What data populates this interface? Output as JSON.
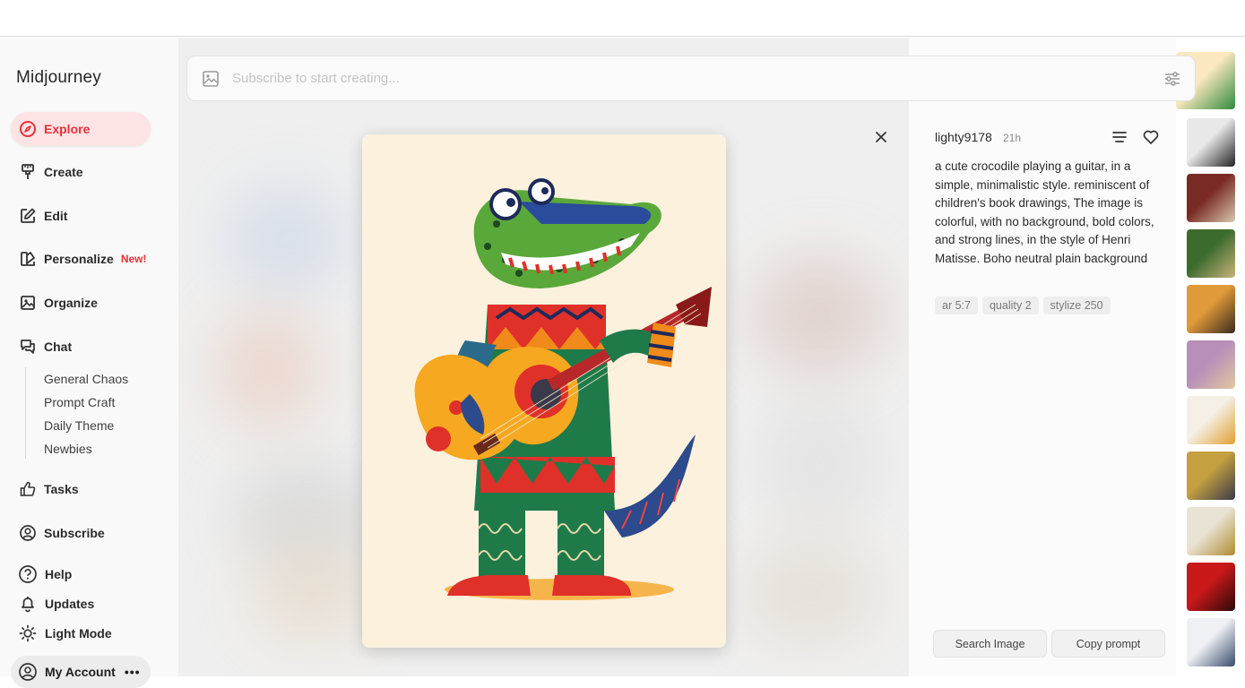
{
  "sidebar": {
    "brand": "Midjourney",
    "nav": {
      "explore": "Explore",
      "create": "Create",
      "edit": "Edit",
      "personalize": "Personalize",
      "personalize_badge": "New!",
      "organize": "Organize",
      "chat": "Chat"
    },
    "chat_channels": [
      "General Chaos",
      "Prompt Craft",
      "Daily Theme",
      "Newbies"
    ],
    "bottom": {
      "tasks": "Tasks",
      "subscribe": "Subscribe",
      "help": "Help",
      "updates": "Updates",
      "light_mode": "Light Mode",
      "account": "My Account"
    },
    "accent_color": "#e5323b"
  },
  "search": {
    "placeholder": "Subscribe to start creating..."
  },
  "detail": {
    "author": "lighty9178",
    "age": "21h",
    "prompt": "a cute crocodile playing a guitar, in a simple, minimalistic style. reminiscent of children's book drawings, The image is colorful, with no background, bold colors, and strong lines, in the style of Henri Matisse. Boho neutral plain background",
    "tags": [
      "ar 5:7",
      "quality 2",
      "stylize 250"
    ],
    "search_image_label": "Search Image",
    "copy_prompt_label": "Copy prompt"
  },
  "thumbnails": [
    {
      "name": "thumb-crocodile",
      "colors": [
        "#fbe8c0",
        "#2f8a3a"
      ]
    },
    {
      "name": "thumb-ink-smoke",
      "colors": [
        "#e8e8e8",
        "#222222"
      ]
    },
    {
      "name": "thumb-car-scene",
      "colors": [
        "#7a2a24",
        "#d8c8b0"
      ]
    },
    {
      "name": "thumb-forest-path",
      "colors": [
        "#3c6b2e",
        "#c9b27a"
      ]
    },
    {
      "name": "thumb-city-street",
      "colors": [
        "#e09a3a",
        "#3a2a1e"
      ]
    },
    {
      "name": "thumb-figures",
      "colors": [
        "#b78fb8",
        "#e0c9a0"
      ]
    },
    {
      "name": "thumb-dancer",
      "colors": [
        "#f5f0e6",
        "#e0a030"
      ]
    },
    {
      "name": "thumb-golden-statue",
      "colors": [
        "#c4a040",
        "#3a3a48"
      ]
    },
    {
      "name": "thumb-golden-car",
      "colors": [
        "#e9e3d5",
        "#b08a30"
      ]
    },
    {
      "name": "thumb-red-portrait",
      "colors": [
        "#c81818",
        "#2a0a0a"
      ]
    },
    {
      "name": "thumb-tulips",
      "colors": [
        "#eef0f4",
        "#3a4a6a"
      ]
    }
  ]
}
